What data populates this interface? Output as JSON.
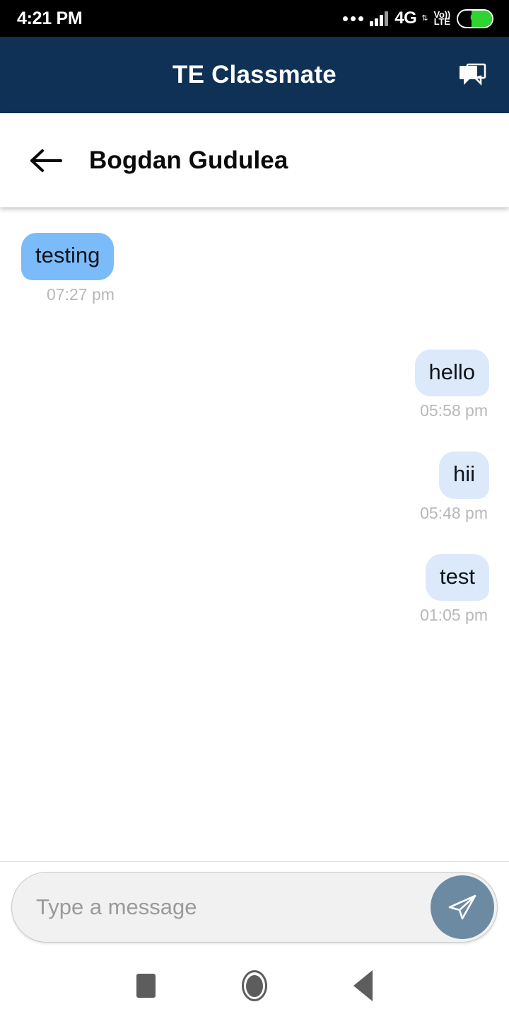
{
  "status_bar": {
    "clock": "4:21 PM",
    "network_label": "4G",
    "network_arrows": "⇅",
    "volte_top": "Vo))",
    "volte_bottom": "LTE",
    "battery_percent": "61",
    "battery_level": 61,
    "icons": [
      "more-dots-icon",
      "signal-bars-icon",
      "volte-icon",
      "battery-icon"
    ],
    "background_color": "#000000"
  },
  "app_bar": {
    "title": "TE Classmate",
    "background_color": "#0f3156",
    "chat_icon_name": "chat-bubbles-icon"
  },
  "contact_header": {
    "back_icon_name": "back-arrow-icon",
    "name": "Bogdan Gudulea"
  },
  "conversation": {
    "messages": [
      {
        "text": "testing",
        "time": "07:27 pm",
        "direction": "incoming"
      },
      {
        "text": "hello",
        "time": "05:58 pm",
        "direction": "outgoing"
      },
      {
        "text": "hii",
        "time": "05:48 pm",
        "direction": "outgoing"
      },
      {
        "text": "test",
        "time": "01:05 pm",
        "direction": "outgoing"
      }
    ],
    "incoming_bubble_color": "#7bbbfa",
    "outgoing_bubble_color": "#dbe9fb",
    "timestamp_color": "#b8b8b8"
  },
  "composer": {
    "placeholder": "Type a message",
    "value": "",
    "send_icon_name": "send-paper-plane-icon",
    "send_button_color": "#6d8aa3"
  },
  "nav_bar": {
    "recents_label": "recents-square-icon",
    "home_label": "home-circle-icon",
    "back_label": "back-triangle-icon"
  }
}
